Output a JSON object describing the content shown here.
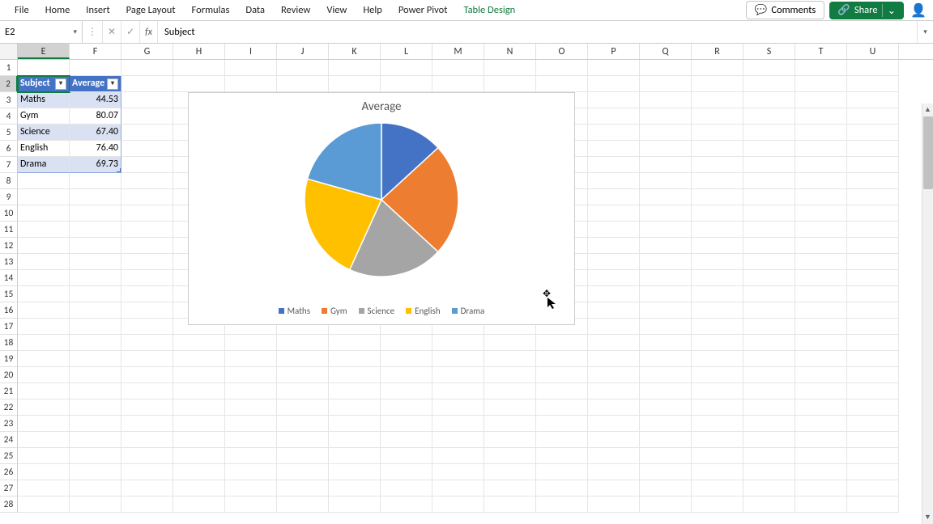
{
  "ribbon": {
    "tabs": [
      "File",
      "Home",
      "Insert",
      "Page Layout",
      "Formulas",
      "Data",
      "Review",
      "View",
      "Help",
      "Power Pivot",
      "Table Design"
    ],
    "context_tab_index": 10,
    "comments_label": "Comments",
    "share_label": "Share"
  },
  "formula_bar": {
    "namebox": "E2",
    "content": "Subject"
  },
  "columns": [
    "E",
    "F",
    "G",
    "H",
    "I",
    "J",
    "K",
    "L",
    "M",
    "N",
    "O",
    "P",
    "Q",
    "R",
    "S",
    "T",
    "U"
  ],
  "selected_col": "E",
  "selected_row": 2,
  "visible_rows": 28,
  "table": {
    "headers": [
      "Subject",
      "Average"
    ],
    "rows": [
      {
        "subject": "Maths",
        "avg": "44.53"
      },
      {
        "subject": "Gym",
        "avg": "80.07"
      },
      {
        "subject": "Science",
        "avg": "67.40"
      },
      {
        "subject": "English",
        "avg": "76.40"
      },
      {
        "subject": "Drama",
        "avg": "69.73"
      }
    ]
  },
  "chart_data": {
    "type": "pie",
    "title": "Average",
    "categories": [
      "Maths",
      "Gym",
      "Science",
      "English",
      "Drama"
    ],
    "values": [
      44.53,
      80.07,
      67.4,
      76.4,
      69.73
    ],
    "colors": [
      "#4472C4",
      "#ED7D31",
      "#A5A5A5",
      "#FFC000",
      "#5B9BD5"
    ],
    "legend_position": "bottom"
  }
}
